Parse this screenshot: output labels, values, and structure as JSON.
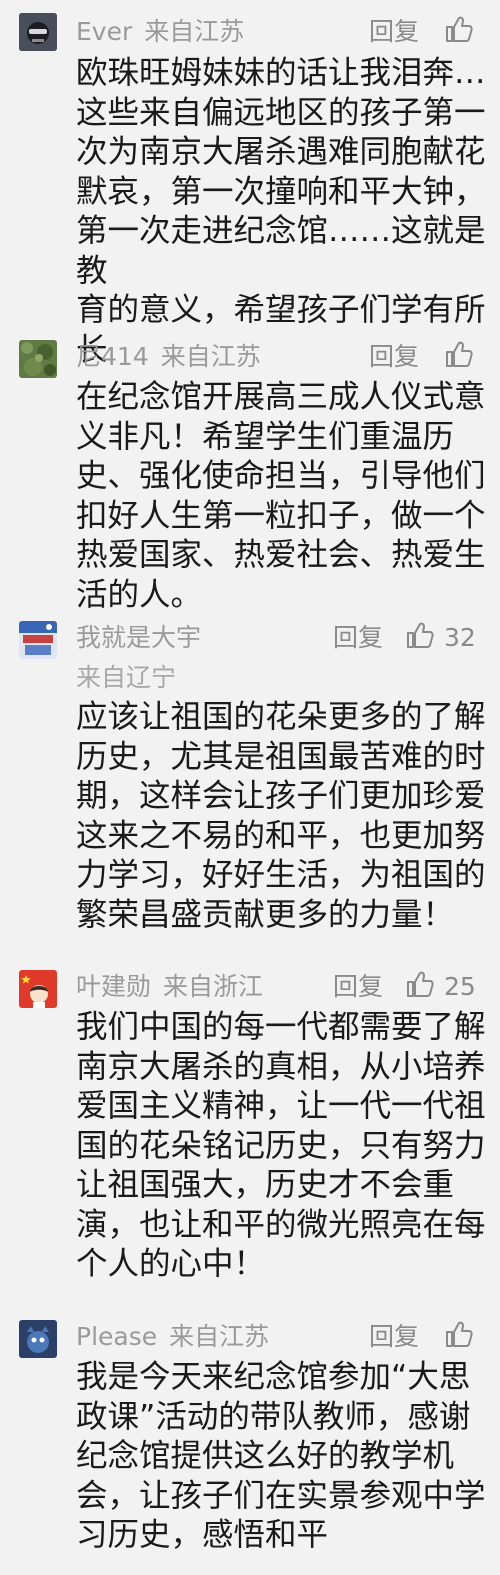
{
  "ui": {
    "reply_label": "回复",
    "like_icon": "thumbs-up-icon"
  },
  "comments": [
    {
      "user": "Ever",
      "location": "来自江苏",
      "likes": "",
      "text": "欧珠旺姆妹妹的话让我泪奔…\n这些来自偏远地区的孩子第一\n次为南京大屠杀遇难同胞献花\n默哀，第一次撞响和平大钟，\n第一次走进纪念馆……这就是教\n育的意义，希望孩子们学有所\n长"
    },
    {
      "user": "尼414",
      "location": "来自江苏",
      "likes": "",
      "text": "在纪念馆开展高三成人仪式意\n义非凡！希望学生们重温历\n史、强化使命担当，引导他们\n扣好人生第一粒扣子，做一个\n热爱国家、热爱社会、热爱生\n活的人。"
    },
    {
      "user": "我就是大宇",
      "location": "来自辽宁",
      "likes": "32",
      "text": "应该让祖国的花朵更多的了解\n历史，尤其是祖国最苦难的时\n期，这样会让孩子们更加珍爱\n这来之不易的和平，也更加努\n力学习，好好生活，为祖国的\n繁荣昌盛贡献更多的力量！"
    },
    {
      "user": "叶建勋",
      "location": "来自浙江",
      "likes": "25",
      "text": "我们中国的每一代都需要了解\n南京大屠杀的真相，从小培养\n爱国主义精神，让一代一代祖\n国的花朵铭记历史，只有努力\n让祖国强大，历史才不会重\n演，也让和平的微光照亮在每\n个人的心中！"
    },
    {
      "user": "Please",
      "location": "来自江苏",
      "likes": "",
      "text": "我是今天来纪念馆参加“大思\n政课”活动的带队教师，感谢\n纪念馆提供这么好的教学机\n会，让孩子们在实景参观中学\n习历史，感悟和平"
    }
  ]
}
